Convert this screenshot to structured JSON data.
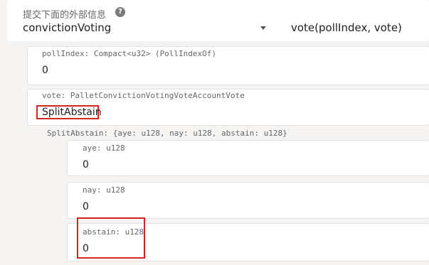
{
  "extrinsic": {
    "label": "提交下面的外部信息",
    "help_icon": "?",
    "section": "convictionVoting",
    "method": "vote(pollIndex, vote)"
  },
  "params": {
    "poll_index": {
      "label": "pollIndex: Compact<u32> (PollIndexOf)",
      "value": "0"
    },
    "vote": {
      "label": "vote: PalletConvictionVotingVoteAccountVote",
      "selected": "SplitAbstain"
    },
    "split_abstain": {
      "label": "SplitAbstain: {aye: u128, nay: u128, abstain: u128}",
      "aye": {
        "label": "aye: u128",
        "value": "0"
      },
      "nay": {
        "label": "nay: u128",
        "value": "0"
      },
      "abstain": {
        "label": "abstain: u128",
        "value": "0"
      }
    }
  },
  "colors": {
    "highlight": "#d62424",
    "background": "#f5f4f3",
    "card": "#ffffff"
  }
}
